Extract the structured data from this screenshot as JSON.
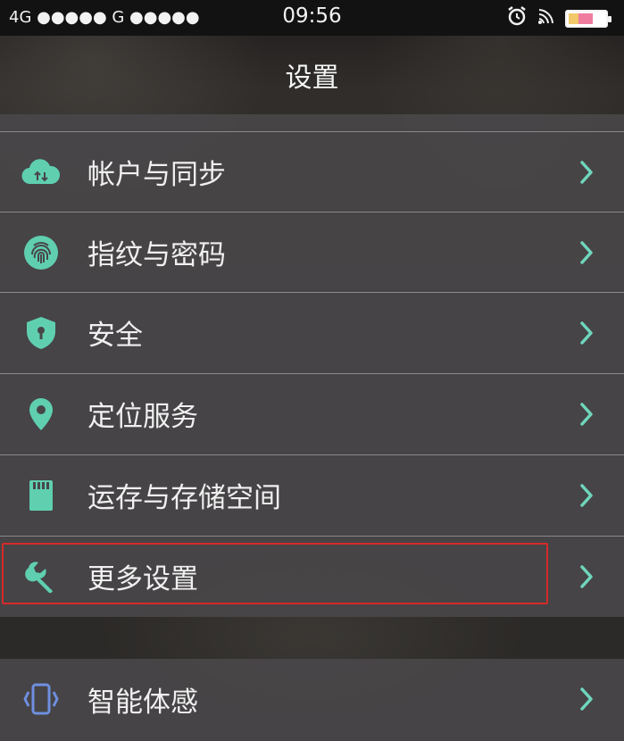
{
  "status_bar": {
    "network": "4G ●●●●● G ●●●●●",
    "time": "09:56",
    "icons": [
      "alarm-icon",
      "wifi-icon",
      "battery-icon"
    ]
  },
  "header": {
    "title": "设置"
  },
  "settings": {
    "items": [
      {
        "label": "帐户与同步",
        "icon": "cloud-sync-icon"
      },
      {
        "label": "指纹与密码",
        "icon": "fingerprint-icon"
      },
      {
        "label": "安全",
        "icon": "shield-icon"
      },
      {
        "label": "定位服务",
        "icon": "location-pin-icon"
      },
      {
        "label": "运存与存储空间",
        "icon": "sd-card-icon"
      },
      {
        "label": "更多设置",
        "icon": "wrench-icon"
      }
    ],
    "items2": [
      {
        "label": "智能体感",
        "icon": "phone-motion-icon"
      }
    ]
  },
  "colors": {
    "accent_teal": "#5fcfb0",
    "accent_blue": "#6f8fe0",
    "highlight_red": "#d62a2a",
    "row_bg": "#484648"
  }
}
